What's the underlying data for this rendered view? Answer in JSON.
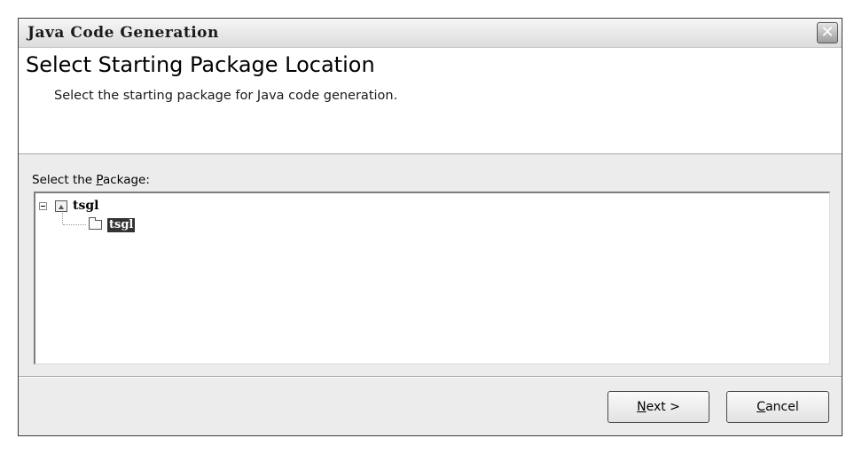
{
  "window": {
    "title": "Java Code Generation",
    "close_symbol": "✕"
  },
  "header": {
    "title": "Select Starting Package Location",
    "subtitle": "Select the starting package for Java code generation."
  },
  "package_label": {
    "before": "Select the ",
    "mnemonic": "P",
    "after": "ackage:"
  },
  "tree": {
    "root": {
      "label": "tsgl",
      "icon": "project-icon",
      "expanded": true
    },
    "children": [
      {
        "label": "tsgl",
        "icon": "folder-icon",
        "selected": true
      }
    ]
  },
  "buttons": {
    "next": {
      "mnemonic": "N",
      "rest": "ext >"
    },
    "cancel": {
      "mnemonic": "C",
      "rest": "ancel"
    }
  }
}
